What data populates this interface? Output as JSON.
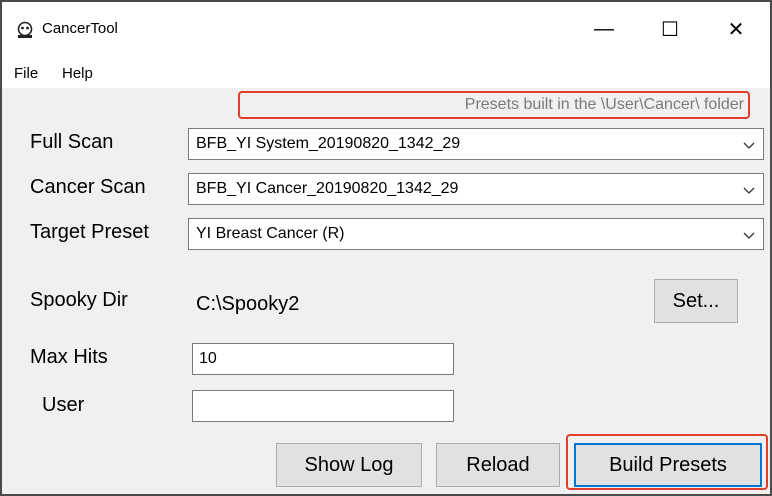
{
  "window": {
    "title": "CancerTool",
    "minimize": "—",
    "maximize": "☐",
    "close": "✕"
  },
  "menu": {
    "file": "File",
    "help": "Help"
  },
  "hint_text": "Presets built in the \\User\\Cancer\\ folder",
  "full_scan": {
    "label": "Full Scan",
    "value": "BFB_YI System_20190820_1342_29"
  },
  "cancer_scan": {
    "label": "Cancer Scan",
    "value": "BFB_YI Cancer_20190820_1342_29"
  },
  "target_preset": {
    "label": "Target Preset",
    "value": "YI Breast Cancer (R)"
  },
  "spooky_dir": {
    "label": "Spooky Dir",
    "value": "C:\\Spooky2",
    "set_button": "Set..."
  },
  "max_hits": {
    "label": "Max Hits",
    "value": "10"
  },
  "user": {
    "label": "User",
    "value": ""
  },
  "buttons": {
    "show_log": "Show Log",
    "reload": "Reload",
    "build_presets": "Build Presets"
  },
  "colors": {
    "highlight": "#e0402a",
    "focus": "#0078d7",
    "window_bg": "#f0f0f0"
  },
  "icons": {
    "app": "spooky-app-icon",
    "dropdown": "chevron-down-icon"
  }
}
